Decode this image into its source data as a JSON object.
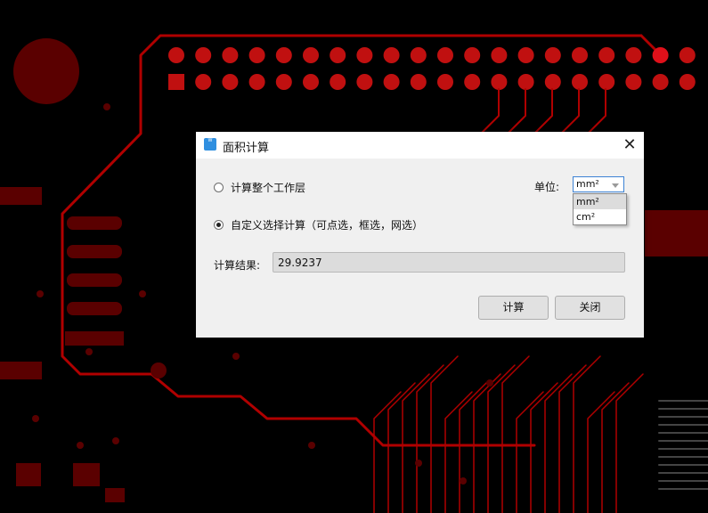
{
  "dialog": {
    "title": "面积计算",
    "app_icon_text": "W",
    "close_glyph": "✕",
    "options": {
      "whole_layer": "计算整个工作层",
      "custom_select": "自定义选择计算（可点选，框选，网选）"
    },
    "selected_option": "custom_select",
    "unit": {
      "label": "单位:",
      "value": "mm²",
      "options": [
        "mm²",
        "cm²"
      ]
    },
    "result": {
      "label": "计算结果:",
      "value": "29.9237"
    },
    "buttons": {
      "calculate": "计算",
      "close": "关闭"
    }
  },
  "colors": {
    "pcb_trace": "#b00000",
    "pcb_pad": "#c01010",
    "pcb_dark": "#5a0000",
    "dialog_bg": "#f0f0f0",
    "accent": "#3c82d4"
  }
}
